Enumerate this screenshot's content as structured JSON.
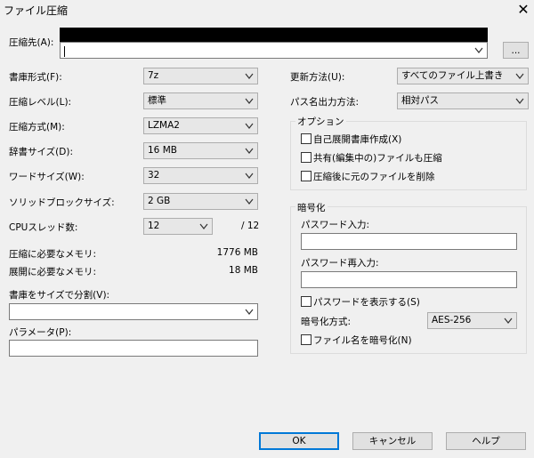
{
  "window": {
    "title": "ファイル圧縮",
    "close_glyph": "✕"
  },
  "archive": {
    "label": "圧縮先(A):",
    "value": "",
    "browse_label": "..."
  },
  "left": {
    "format": {
      "label": "書庫形式(F):",
      "value": "7z"
    },
    "level": {
      "label": "圧縮レベル(L):",
      "value": "標準"
    },
    "method": {
      "label": "圧縮方式(M):",
      "value": "LZMA2"
    },
    "dict": {
      "label": "辞書サイズ(D):",
      "value": "16 MB"
    },
    "word": {
      "label": "ワードサイズ(W):",
      "value": "32"
    },
    "solid": {
      "label": "ソリッドブロックサイズ:",
      "value": "2 GB"
    },
    "cpu": {
      "label": "CPUスレッド数:",
      "value": "12",
      "total": "/ 12"
    },
    "mem_comp": {
      "label": "圧縮に必要なメモリ:",
      "value": "1776 MB"
    },
    "mem_decomp": {
      "label": "展開に必要なメモリ:",
      "value": "18 MB"
    },
    "split": {
      "label": "書庫をサイズで分割(V):",
      "value": ""
    },
    "params": {
      "label": "パラメータ(P):",
      "value": ""
    }
  },
  "right": {
    "update": {
      "label": "更新方法(U):",
      "value": "すべてのファイル上書き"
    },
    "pathmode": {
      "label": "パス名出力方法:",
      "value": "相対パス"
    },
    "options": {
      "title": "オプション",
      "sfx": {
        "label": "自己展開書庫作成(X)",
        "checked": false
      },
      "shared": {
        "label": "共有(編集中の)ファイルも圧縮",
        "checked": false
      },
      "delete": {
        "label": "圧縮後に元のファイルを削除",
        "checked": false
      }
    },
    "encryption": {
      "title": "暗号化",
      "pw_label": "パスワード入力:",
      "pw_value": "",
      "pw2_label": "パスワード再入力:",
      "pw2_value": "",
      "show_pw": {
        "label": "パスワードを表示する(S)",
        "checked": false
      },
      "method": {
        "label": "暗号化方式:",
        "value": "AES-256"
      },
      "enc_names": {
        "label": "ファイル名を暗号化(N)",
        "checked": false
      }
    }
  },
  "buttons": {
    "ok": "OK",
    "cancel": "キャンセル",
    "help": "ヘルプ"
  }
}
